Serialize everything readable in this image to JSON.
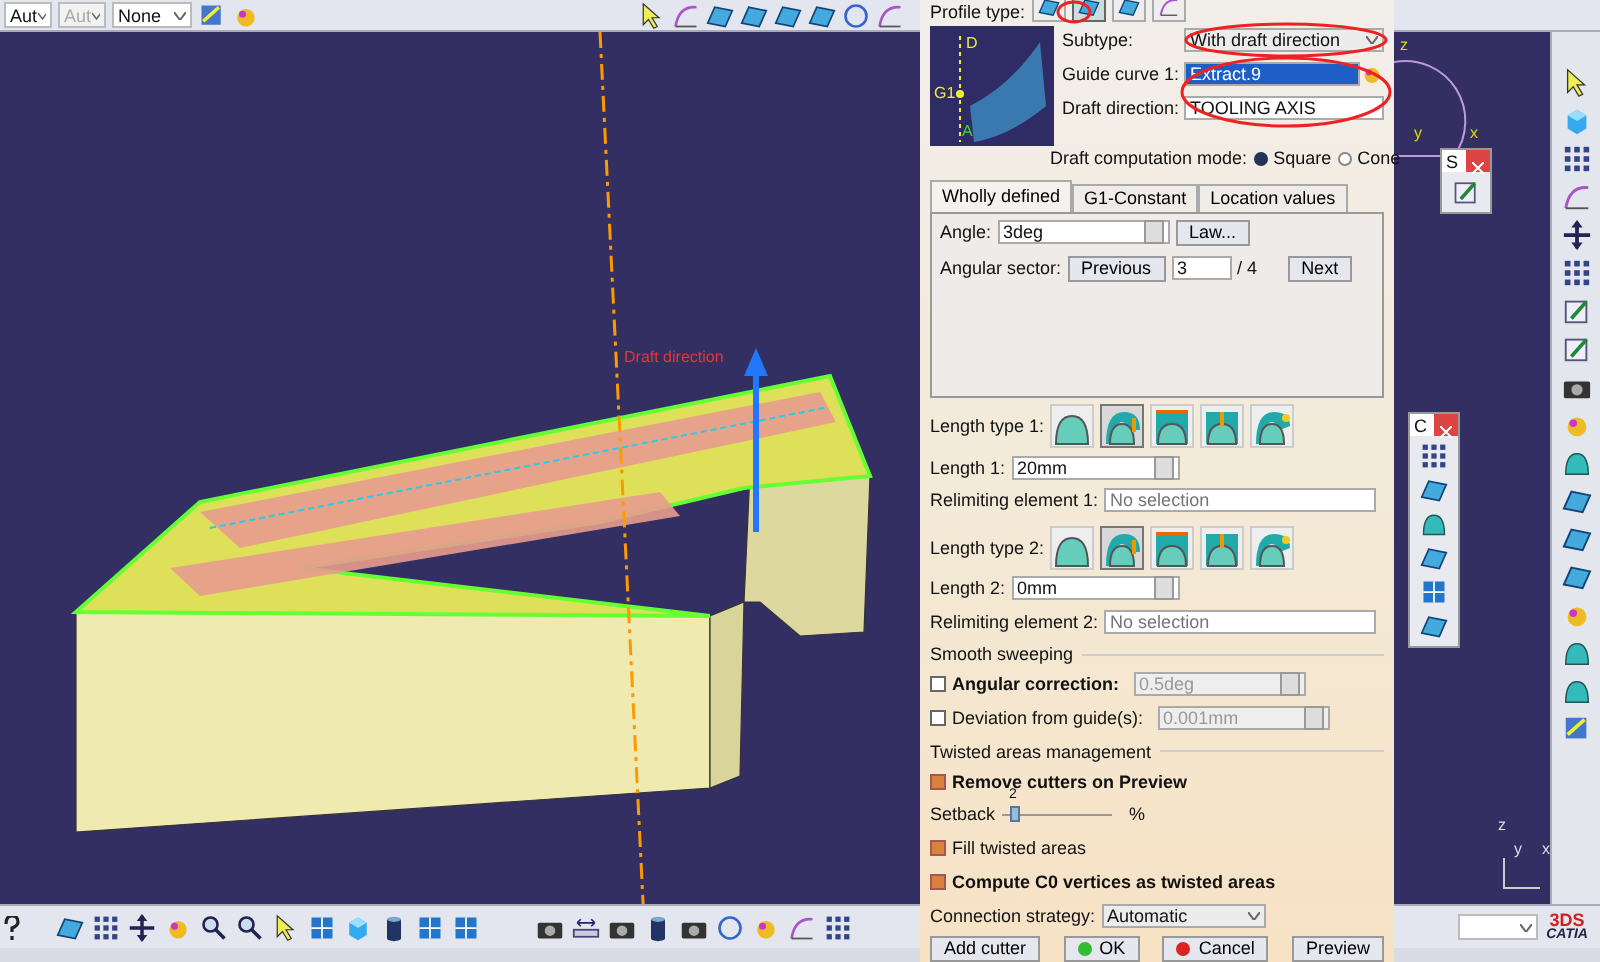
{
  "top_toolbar": {
    "dropdowns": [
      {
        "value": "Aut",
        "disabled": false
      },
      {
        "value": "Aut",
        "disabled": true
      },
      {
        "value": "None",
        "disabled": false
      }
    ]
  },
  "viewport": {
    "labels": [
      "Draft direction"
    ],
    "compass_axes": [
      "z",
      "y",
      "x"
    ],
    "triad_axes": [
      "z",
      "y",
      "x"
    ]
  },
  "floating_toolbars": [
    {
      "title": "S"
    },
    {
      "title": "C"
    }
  ],
  "dialog": {
    "profile_type": {
      "label": "Profile type:",
      "options": [
        {
          "selected": false
        },
        {
          "selected": true
        },
        {
          "selected": false
        },
        {
          "selected": false
        }
      ]
    },
    "diagram_labels": [
      "D",
      "G1",
      "A"
    ],
    "subtype": {
      "label": "Subtype:",
      "value": "With draft direction"
    },
    "guide_curve": {
      "label": "Guide curve 1:",
      "value": "Extract.9"
    },
    "draft_direction": {
      "label": "Draft direction:",
      "value": "TOOLING AXIS"
    },
    "draft_mode": {
      "label": "Draft computation mode:",
      "options": [
        {
          "label": "Square",
          "selected": true
        },
        {
          "label": "Cone",
          "selected": false
        }
      ]
    },
    "tabs": [
      {
        "label": "Wholly defined",
        "selected": true
      },
      {
        "label": "G1-Constant",
        "selected": false
      },
      {
        "label": "Location values",
        "selected": false
      }
    ],
    "angle": {
      "label": "Angle:",
      "value": "3deg",
      "button": "Law..."
    },
    "angular_sector": {
      "label": "Angular sector:",
      "previous": "Previous",
      "value": "3",
      "total": "/ 4",
      "next": "Next"
    },
    "lengths": [
      {
        "type_label": "Length type 1:",
        "options": [
          {
            "selected": false
          },
          {
            "selected": true
          },
          {
            "selected": false
          },
          {
            "selected": false
          },
          {
            "selected": false
          }
        ],
        "length_label": "Length 1:",
        "length_value": "20mm",
        "relimiting_label": "Relimiting element 1:",
        "relimiting_placeholder": "No selection"
      },
      {
        "type_label": "Length type 2:",
        "options": [
          {
            "selected": false
          },
          {
            "selected": true
          },
          {
            "selected": false
          },
          {
            "selected": false
          },
          {
            "selected": false
          }
        ],
        "length_label": "Length 2:",
        "length_value": "0mm",
        "relimiting_label": "Relimiting element 2:",
        "relimiting_placeholder": "No selection"
      }
    ],
    "smooth_sweeping": {
      "title": "Smooth sweeping",
      "options": [
        {
          "label": "Angular correction:",
          "checked": false,
          "value": "0.5deg"
        },
        {
          "label": "Deviation from guide(s):",
          "checked": false,
          "value": "0.001mm"
        }
      ]
    },
    "twisted_areas": {
      "title": "Twisted areas management",
      "remove_cutters": {
        "label": "Remove cutters on Preview",
        "checked": true
      },
      "setback": {
        "label": "Setback",
        "value": "2",
        "unit": "%",
        "level": 0.08
      },
      "fill": {
        "label": "Fill twisted areas",
        "checked": true
      },
      "compute_c0": {
        "label": "Compute C0 vertices as twisted areas",
        "checked": true
      }
    },
    "connection_strategy": {
      "label": "Connection strategy:",
      "value": "Automatic"
    },
    "buttons": [
      {
        "label": "Add cutter",
        "kind": "plain"
      },
      {
        "label": "OK",
        "kind": "ok"
      },
      {
        "label": "Cancel",
        "kind": "cancel"
      },
      {
        "label": "Preview",
        "kind": "plain"
      }
    ]
  },
  "logo": {
    "brand": "3DS",
    "name": "CATIA"
  }
}
